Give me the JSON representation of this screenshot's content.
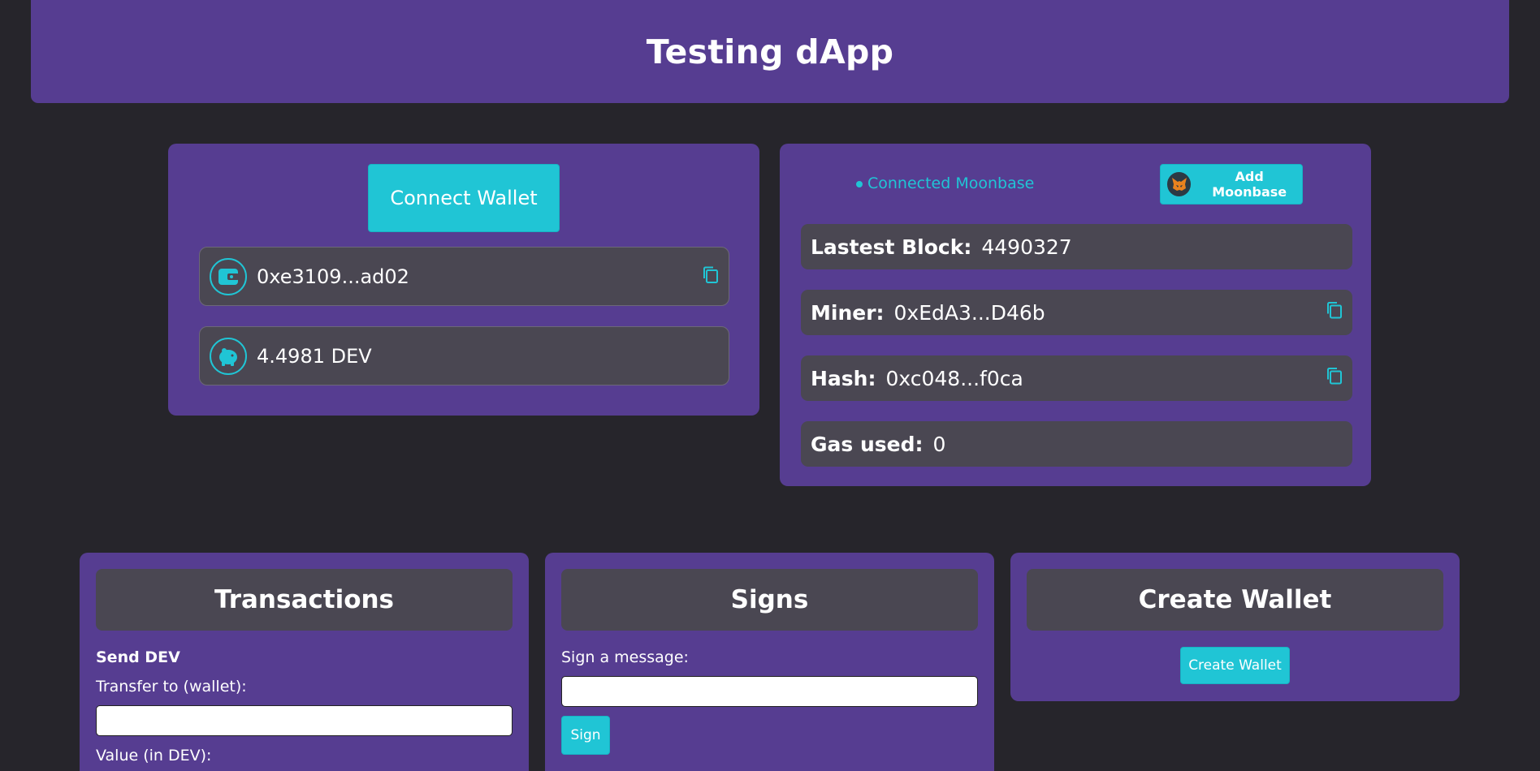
{
  "header": {
    "title": "Testing dApp"
  },
  "wallet": {
    "connect_label": "Connect Wallet",
    "address": "0xe3109...ad02",
    "balance": "4.4981 DEV"
  },
  "network": {
    "status": "Connected Moonbase",
    "add_button_label": "Add Moonbase",
    "rows": [
      {
        "label": "Lastest Block:",
        "value": "4490327"
      },
      {
        "label": "Miner:",
        "value": "0xEdA3...D46b"
      },
      {
        "label": "Hash:",
        "value": "0xc048...f0ca"
      },
      {
        "label": "Gas used:",
        "value": "0"
      }
    ]
  },
  "transactions": {
    "title": "Transactions",
    "section": "Send DEV",
    "transfer_label": "Transfer to (wallet):",
    "value_label": "Value (in DEV):"
  },
  "signs": {
    "title": "Signs",
    "message_label": "Sign a message:",
    "sign_button": "Sign"
  },
  "create_wallet": {
    "title": "Create Wallet",
    "button_label": "Create Wallet"
  },
  "colors": {
    "background": "#26252b",
    "panel": "#563d91",
    "row": "#4a4752",
    "accent": "#20c5d5"
  },
  "icons": [
    "wallet-icon",
    "piggy-bank-icon",
    "copy-icon",
    "metamask-fox-icon",
    "status-dot-icon"
  ]
}
